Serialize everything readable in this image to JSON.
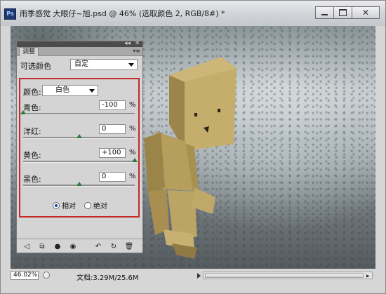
{
  "window": {
    "title": "雨季感觉 大眼仔~旭.psd @ 46% (选取颜色 2, RGB/8#) *",
    "app_icon_label": "Ps",
    "buttons": [
      "minimize",
      "maximize",
      "close"
    ]
  },
  "panel": {
    "tab_label": "调整",
    "preset_label": "可选颜色",
    "preset_value": "自定",
    "color_label": "颜色:",
    "color_value": "白色",
    "sliders": [
      {
        "label": "青色:",
        "value": "-100",
        "unit": "%",
        "level": 0.0
      },
      {
        "label": "洋红:",
        "value": "0",
        "unit": "%",
        "level": 0.5
      },
      {
        "label": "黄色:",
        "value": "+100",
        "unit": "%",
        "level": 1.0
      },
      {
        "label": "黑色:",
        "value": "0",
        "unit": "%",
        "level": 0.5
      }
    ],
    "method_options": [
      "相对",
      "绝对"
    ],
    "method_selected": "相对",
    "footer_icons": [
      "back-arrow-icon",
      "expand-view-icon",
      "clip-layer-icon",
      "visibility-eye-icon",
      "view-previous-icon",
      "reset-icon",
      "delete-icon"
    ]
  },
  "status": {
    "zoom": "46.02%",
    "doc_info": "文档:3.29M/25.6M"
  }
}
